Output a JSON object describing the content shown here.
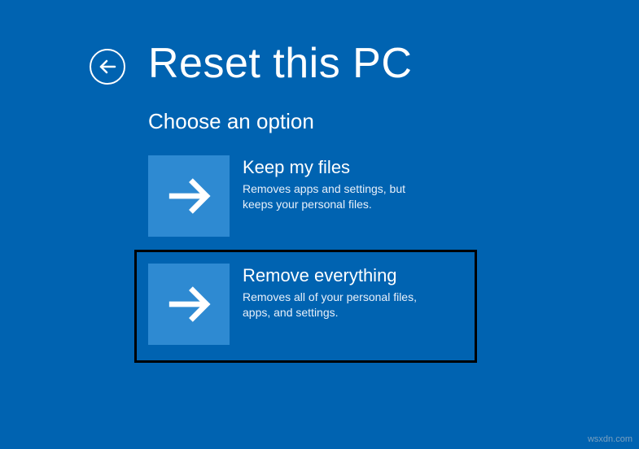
{
  "header": {
    "title": "Reset this PC"
  },
  "subtitle": "Choose an option",
  "options": [
    {
      "title": "Keep my files",
      "description": "Removes apps and settings, but keeps your personal files."
    },
    {
      "title": "Remove everything",
      "description": "Removes all of your personal files, apps, and settings."
    }
  ],
  "watermark": "wsxdn.com"
}
